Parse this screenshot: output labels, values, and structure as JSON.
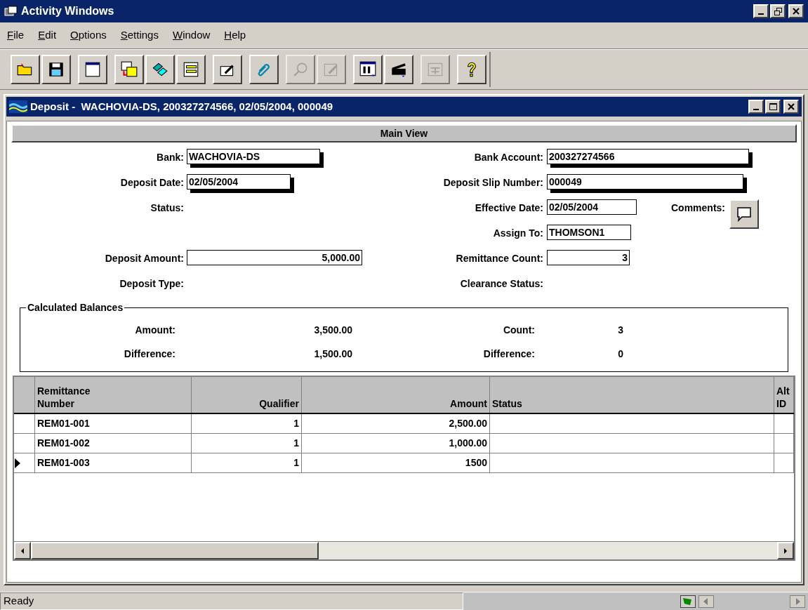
{
  "window": {
    "title": "Activity Windows"
  },
  "menu": [
    {
      "label": "File"
    },
    {
      "label": "Edit"
    },
    {
      "label": "Options"
    },
    {
      "label": "Settings"
    },
    {
      "label": "Window"
    },
    {
      "label": "Help"
    }
  ],
  "toolbar": [
    {
      "disabled": false
    },
    {
      "disabled": false
    },
    {
      "disabled": false
    },
    {
      "disabled": false
    },
    {
      "disabled": false
    },
    {
      "disabled": false
    },
    {
      "disabled": false
    },
    {
      "disabled": false
    },
    {
      "disabled": true
    },
    {
      "disabled": true
    },
    {
      "disabled": false
    },
    {
      "disabled": false
    },
    {
      "disabled": true
    },
    {
      "disabled": false
    }
  ],
  "document": {
    "title": "Deposit -  WACHOVIA-DS, 200327274566, 02/05/2004, 000049",
    "view_title": "Main View",
    "rows": [
      {
        "left": {
          "label": "Bank:",
          "value": "WACHOVIA-DS",
          "kind": "boxed"
        },
        "right": {
          "label": "Bank Account:",
          "value": "200327274566",
          "kind": "boxed"
        }
      },
      {
        "left": {
          "label": "Deposit Date:",
          "value": "02/05/2004",
          "kind": "boxed"
        },
        "right": {
          "label": "Deposit Slip Number:",
          "value": "000049",
          "kind": "boxed"
        }
      },
      {
        "left": {
          "label": "Status:",
          "kind": "none"
        },
        "right": {
          "label": "Effective Date:",
          "value": "02/05/2004",
          "kind": "plain"
        }
      },
      {
        "right": {
          "label": "Assign To:",
          "value": "THOMSON1",
          "kind": "plain"
        }
      },
      {
        "left": {
          "label": "Deposit Amount:",
          "value": "5,000.00",
          "kind": "numeric"
        },
        "right": {
          "label": "Remittance Count:",
          "value": "3",
          "kind": "numeric"
        }
      },
      {
        "left": {
          "label": "Deposit Type:",
          "kind": "none"
        },
        "right": {
          "label": "Clearance Status:",
          "kind": "none"
        }
      }
    ],
    "comments": {
      "label": "Comments:"
    },
    "balances": {
      "title": "Calculated Balances",
      "rows": [
        {
          "label": "Amount:",
          "value": "3,500.00",
          "label_2": "Count:",
          "value_2": "3"
        },
        {
          "label": "Difference:",
          "value": "1,500.00",
          "label_2": "Difference:",
          "value_2": "0"
        }
      ]
    },
    "grid": {
      "columns": [
        "Remittance Number",
        "Qualifier",
        "Amount",
        "Status",
        "Alt ID"
      ],
      "rows": [
        {
          "selected": false,
          "cells": [
            "REM01-001",
            "1",
            "2,500.00"
          ]
        },
        {
          "selected": false,
          "cells": [
            "REM01-002",
            "1",
            "1,000.00"
          ]
        },
        {
          "selected": true,
          "cells": [
            "REM01-003",
            "1",
            "1500"
          ]
        }
      ]
    }
  },
  "status_bar": {
    "text": "Ready"
  }
}
